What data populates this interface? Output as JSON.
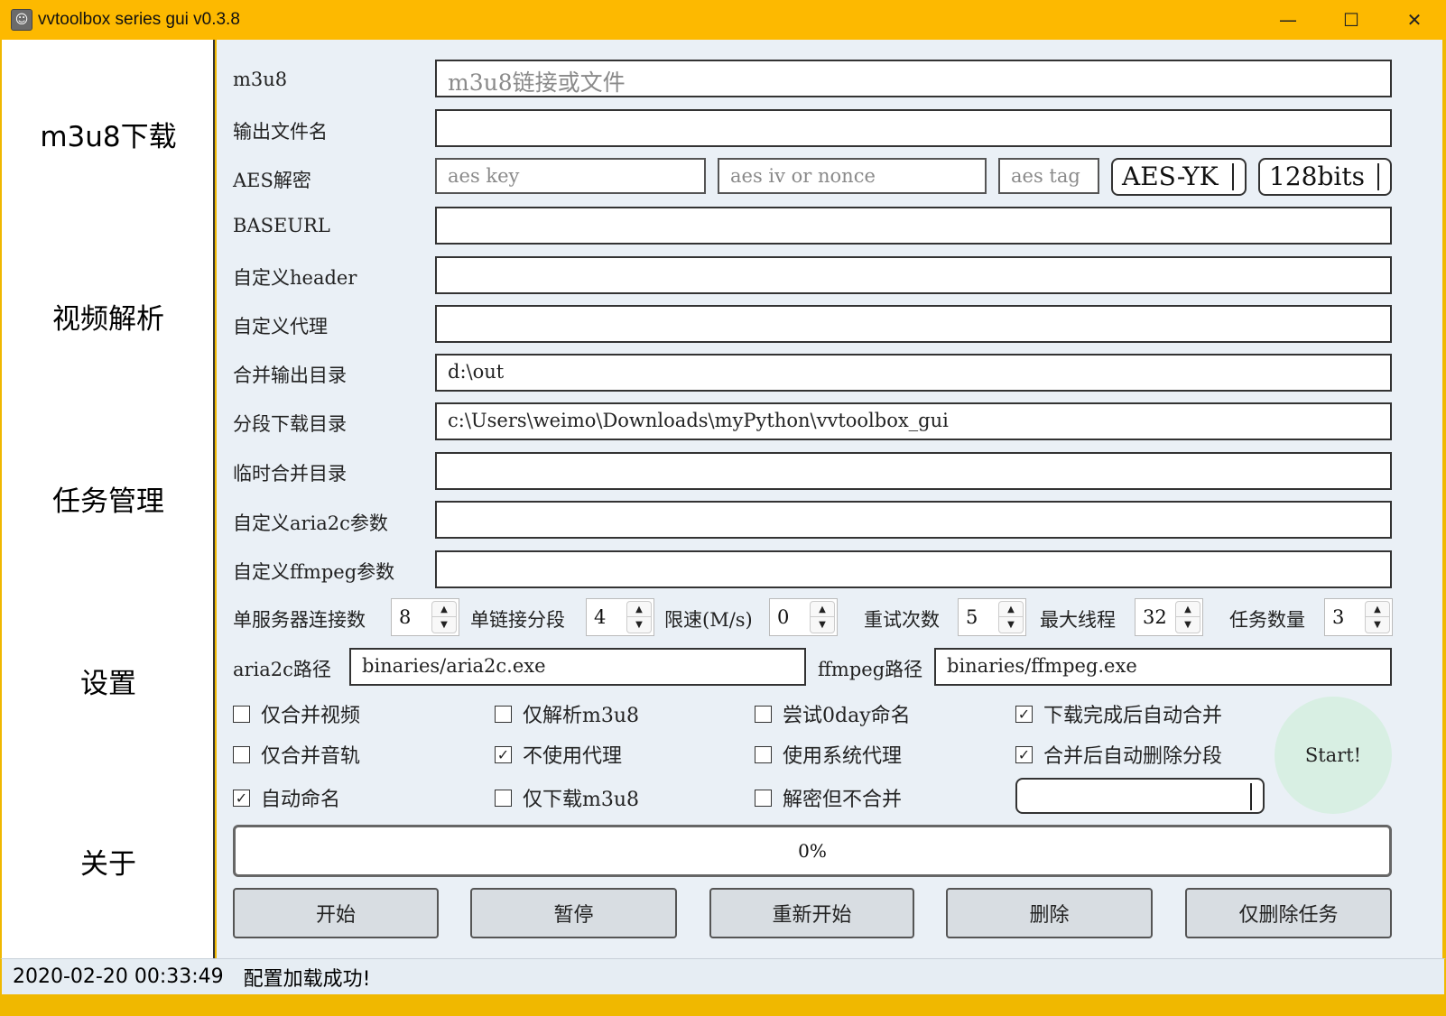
{
  "window": {
    "title": "vvtoolbox series gui v0.3.8",
    "minimize": "—",
    "maximize": "☐",
    "close": "✕"
  },
  "sidebar": {
    "items": [
      {
        "label": "m3u8下载"
      },
      {
        "label": "视频解析"
      },
      {
        "label": "任务管理"
      },
      {
        "label": "设置"
      },
      {
        "label": "关于"
      }
    ]
  },
  "form": {
    "m3u8": {
      "label": "m3u8",
      "value": "",
      "placeholder": "m3u8链接或文件"
    },
    "output_name": {
      "label": "输出文件名",
      "value": ""
    },
    "aes": {
      "label": "AES解密",
      "key_placeholder": "aes key",
      "iv_placeholder": "aes iv or nonce",
      "tag_placeholder": "aes tag",
      "mode": "AES-YK",
      "bits": "128bits"
    },
    "baseurl": {
      "label": "BASEURL",
      "value": ""
    },
    "header": {
      "label": "自定义header",
      "value": ""
    },
    "proxy": {
      "label": "自定义代理",
      "value": ""
    },
    "merge_dir": {
      "label": "合并输出目录",
      "value": "d:\\out"
    },
    "segment_dir": {
      "label": "分段下载目录",
      "value": "c:\\Users\\weimo\\Downloads\\myPython\\vvtoolbox_gui"
    },
    "temp_dir": {
      "label": "临时合并目录",
      "value": ""
    },
    "aria2c_args": {
      "label": "自定义aria2c参数",
      "value": ""
    },
    "ffmpeg_args": {
      "label": "自定义ffmpeg参数",
      "value": ""
    }
  },
  "spinners": [
    {
      "label": "单服务器连接数",
      "value": "8"
    },
    {
      "label": "单链接分段",
      "value": "4"
    },
    {
      "label": "限速(M/s)",
      "value": "0"
    },
    {
      "label": "重试次数",
      "value": "5"
    },
    {
      "label": "最大线程",
      "value": "32"
    },
    {
      "label": "任务数量",
      "value": "3"
    }
  ],
  "paths": {
    "aria2c_label": "aria2c路径",
    "aria2c_value": "binaries/aria2c.exe",
    "ffmpeg_label": "ffmpeg路径",
    "ffmpeg_value": "binaries/ffmpeg.exe"
  },
  "checkboxes": [
    {
      "label": "仅合并视频",
      "checked": false
    },
    {
      "label": "仅解析m3u8",
      "checked": false
    },
    {
      "label": "尝试0day命名",
      "checked": false
    },
    {
      "label": "下载完成后自动合并",
      "checked": true
    },
    {
      "label": "仅合并音轨",
      "checked": false
    },
    {
      "label": "不使用代理",
      "checked": true
    },
    {
      "label": "使用系统代理",
      "checked": false
    },
    {
      "label": "合并后自动删除分段",
      "checked": true
    },
    {
      "label": "自动命名",
      "checked": true
    },
    {
      "label": "仅下载m3u8",
      "checked": false
    },
    {
      "label": "解密但不合并",
      "checked": false
    }
  ],
  "extra_dropdown": {
    "value": ""
  },
  "start_button": "Start!",
  "progress": {
    "text": "0%",
    "value": 0
  },
  "buttons": [
    {
      "label": "开始"
    },
    {
      "label": "暂停"
    },
    {
      "label": "重新开始"
    },
    {
      "label": "删除"
    },
    {
      "label": "仅删除任务"
    }
  ],
  "statusbar": {
    "timestamp": "2020-02-20 00:33:49",
    "message": "配置加载成功!"
  },
  "colors": {
    "titlebar": "#fdb900",
    "main_bg": "#eaf0f6",
    "start_button_bg": "#d8efe3"
  }
}
